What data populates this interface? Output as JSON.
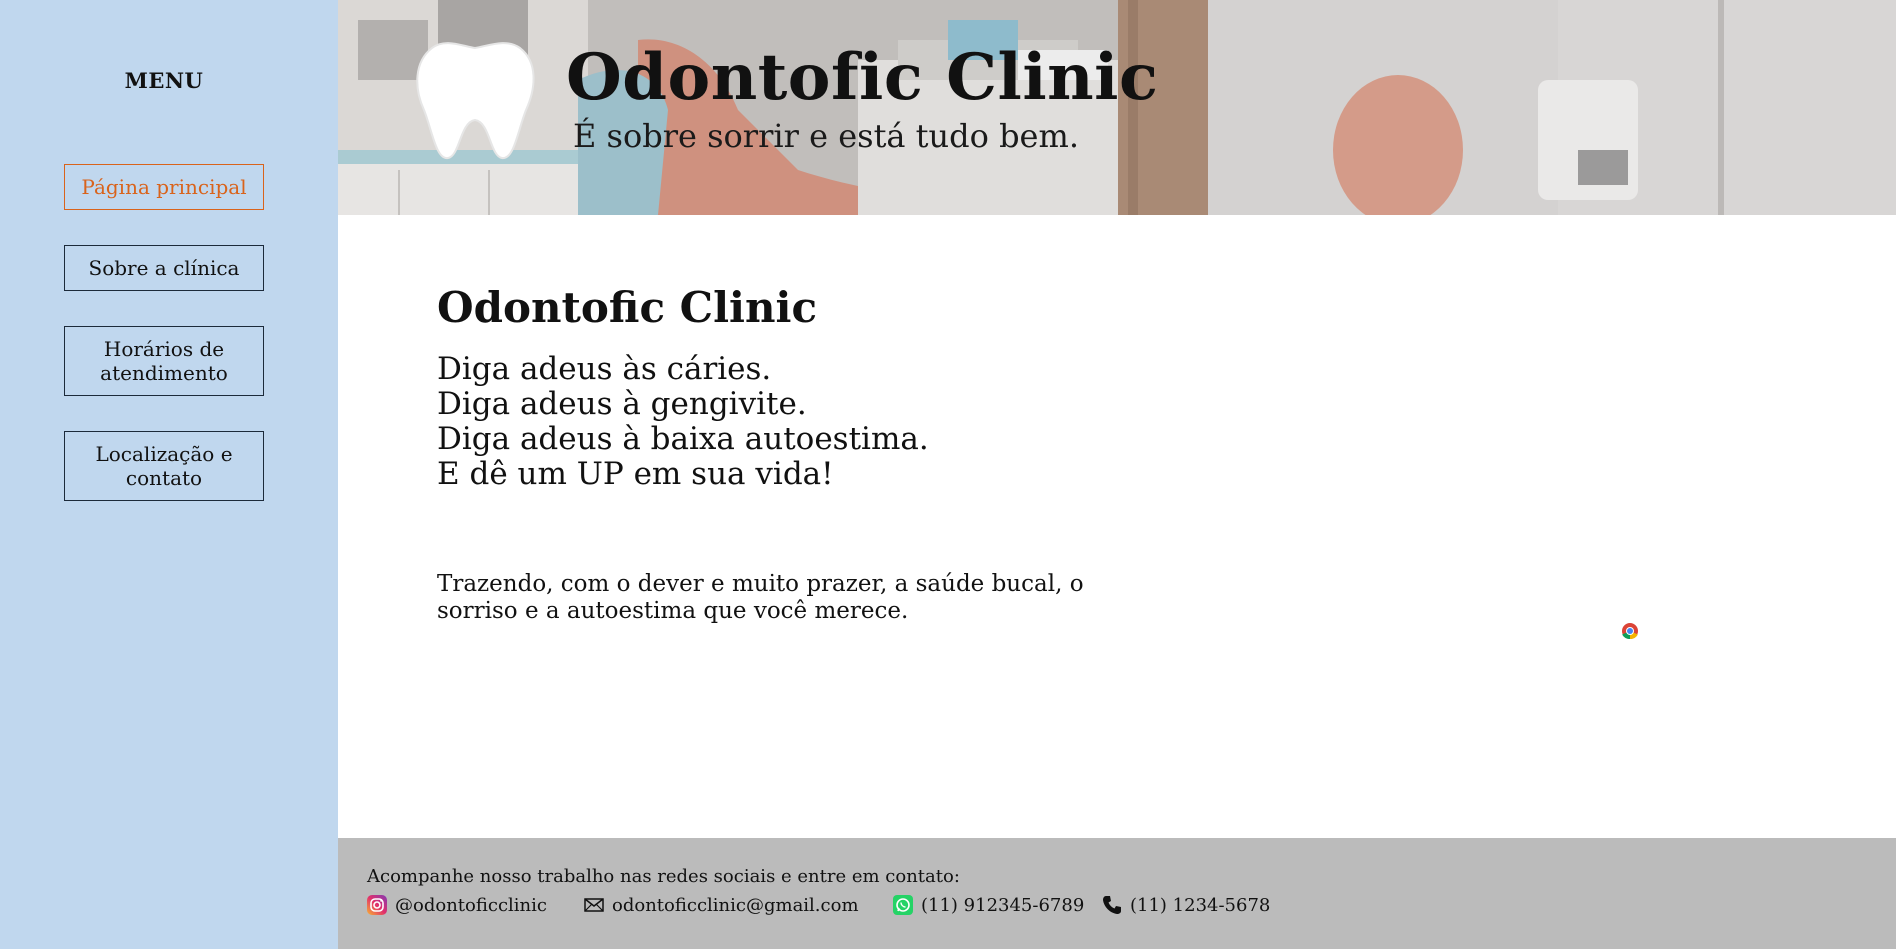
{
  "sidebar": {
    "menu_title": "MENU",
    "items": [
      {
        "label": "Página principal",
        "active": true
      },
      {
        "label": "Sobre a clínica",
        "active": false
      },
      {
        "label": "Horários de atendimento",
        "active": false
      },
      {
        "label": "Localização e contato",
        "active": false
      }
    ]
  },
  "header": {
    "title": "Odontofic Clinic",
    "subtitle": "É sobre sorrir e está tudo bem."
  },
  "main": {
    "title": "Odontofic Clinic",
    "taglines": [
      "Diga adeus às cáries.",
      "Diga adeus à gengivite.",
      "Diga adeus à baixa autoestima.",
      "E dê um UP em sua vida!"
    ],
    "mission": "Trazendo, com o dever e muito prazer, a saúde bucal, o sorriso e a autoestima que você merece."
  },
  "footer": {
    "lead": "Acompanhe nosso trabalho nas redes sociais e entre em contato:",
    "contacts": [
      {
        "icon": "instagram-icon",
        "text": "@odontoficclinic"
      },
      {
        "icon": "mail-icon",
        "text": "odontoficclinic@gmail.com"
      },
      {
        "icon": "whatsapp-icon",
        "text": "(11) 912345-6789"
      },
      {
        "icon": "phone-icon",
        "text": "(11) 1234-5678"
      }
    ]
  },
  "colors": {
    "sidebar_bg": "#c0d7ee",
    "active_accent": "#d9631b",
    "footer_bg": "#bbbbbb",
    "body_bg": "#ffffff"
  }
}
